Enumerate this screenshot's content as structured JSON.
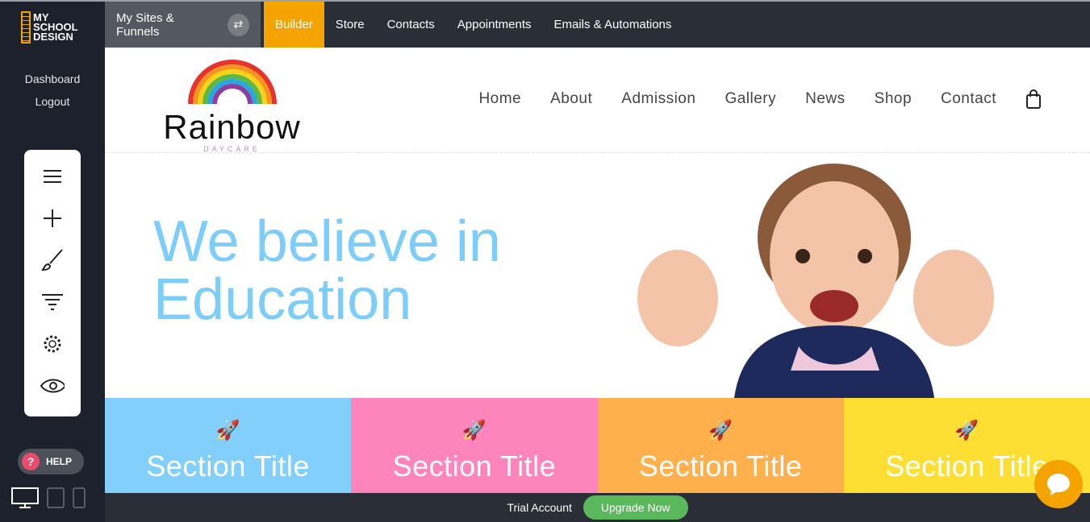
{
  "app": {
    "logo_lines": [
      "MY",
      "SCHOOL",
      "DESIGN"
    ],
    "dashboard": "Dashboard",
    "logout": "Logout",
    "help": "HELP"
  },
  "topnav": {
    "sites": "My Sites & Funnels",
    "tabs": [
      "Builder",
      "Store",
      "Contacts",
      "Appointments",
      "Emails & Automations"
    ],
    "active": "Builder"
  },
  "tools": [
    "menu-icon",
    "plus-icon",
    "brush-icon",
    "filter-icon",
    "gear-icon",
    "eye-icon"
  ],
  "site": {
    "brand": "Rainbow",
    "brand_sub": "DAYCARE",
    "nav": [
      "Home",
      "About",
      "Admission",
      "Gallery",
      "News",
      "Shop",
      "Contact"
    ],
    "headline_1": "We believe in",
    "headline_2": "Education",
    "sections": [
      {
        "title": "Section Title",
        "color": "#81cffa"
      },
      {
        "title": "Section Title",
        "color": "#fe85bc"
      },
      {
        "title": "Section Title",
        "color": "#fdb04b"
      },
      {
        "title": "Section Title",
        "color": "#fddf34"
      }
    ]
  },
  "footer": {
    "trial": "Trial Account",
    "upgrade": "Upgrade Now"
  },
  "colors": {
    "accent": "#f5a300",
    "upgrade": "#5cb85c",
    "headline": "#7dcdfa"
  }
}
